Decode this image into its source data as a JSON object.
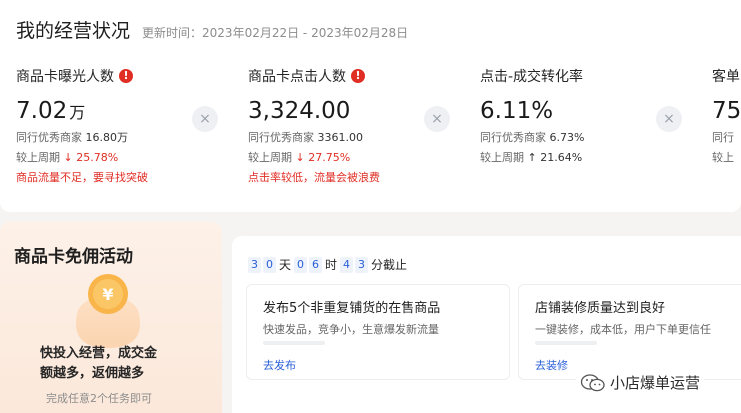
{
  "header": {
    "title": "我的经营状况",
    "update_label": "更新时间：",
    "update_range": "2023年02月22日 - 2023年02月28日"
  },
  "metrics": [
    {
      "title": "商品卡曝光人数",
      "has_warning": true,
      "value": "7.02",
      "unit": "万",
      "peer_label": "同行优秀商家",
      "peer_value": "16.80万",
      "change_label": "较上周期",
      "change_arrow": "↓",
      "change_value": "25.78%",
      "change_dir": "down",
      "alert": "商品流量不足，要寻找突破"
    },
    {
      "title": "商品卡点击人数",
      "has_warning": true,
      "value": "3,324.00",
      "unit": "",
      "peer_label": "同行优秀商家",
      "peer_value": "3361.00",
      "change_label": "较上周期",
      "change_arrow": "↓",
      "change_value": "27.75%",
      "change_dir": "down",
      "alert": "点击率较低，流量会被浪费"
    },
    {
      "title": "点击-成交转化率",
      "has_warning": false,
      "value": "6.11%",
      "unit": "",
      "peer_label": "同行优秀商家",
      "peer_value": "6.73%",
      "change_label": "较上周期",
      "change_arrow": "↑",
      "change_value": "21.64%",
      "change_dir": "up",
      "alert": ""
    },
    {
      "title": "客单",
      "has_warning": false,
      "value": "75",
      "unit": "",
      "peer_label": "同行",
      "peer_value": "",
      "change_label": "较上",
      "change_arrow": "",
      "change_value": "",
      "change_dir": "",
      "alert": ""
    }
  ],
  "close_icon": "×",
  "promo": {
    "title": "商品卡免佣活动",
    "text_line1": "快投入经营，成交金",
    "text_line2": "额越多，返佣越多",
    "sub": "完成任意2个任务即可"
  },
  "countdown": {
    "digits": [
      "3",
      "0",
      "0",
      "6",
      "4",
      "3"
    ],
    "day_unit": "天",
    "hour_unit": "时",
    "min_unit": "分截止"
  },
  "tasks": [
    {
      "title": "发布5个非重复铺货的在售商品",
      "desc": "快速发品，竞争小，生意爆发新流量",
      "link": "去发布"
    },
    {
      "title": "店铺装修质量达到良好",
      "desc": "一键装修，成本低，用户下单更信任",
      "link": "去装修"
    }
  ],
  "watermark": {
    "text": "小店爆单运营"
  },
  "colors": {
    "alert_red": "#e02e24",
    "link_blue": "#2a5fd8",
    "promo_bg": "#fbe8da"
  }
}
